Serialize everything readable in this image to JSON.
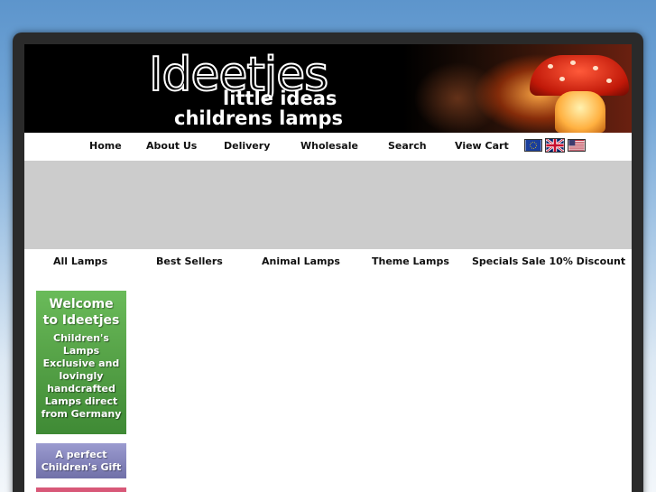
{
  "brand": {
    "name": "Ideetjes",
    "tagline_1": "little ideas",
    "tagline_2": "childrens lamps"
  },
  "top_nav": [
    {
      "label": "Home"
    },
    {
      "label": "About Us"
    },
    {
      "label": "Delivery"
    },
    {
      "label": "Wholesale"
    },
    {
      "label": "Search"
    },
    {
      "label": "View Cart"
    }
  ],
  "flags": [
    "eu-flag-icon",
    "uk-flag-icon",
    "us-flag-icon"
  ],
  "category_nav": [
    {
      "label": "All Lamps"
    },
    {
      "label": "Best Sellers"
    },
    {
      "label": "Animal Lamps"
    },
    {
      "label": "Theme Lamps"
    },
    {
      "label": "Specials Sale 10% Discount"
    }
  ],
  "sidebar": {
    "welcome_title_1": "Welcome",
    "welcome_title_2": "to Ideetjes",
    "welcome_lines": [
      "Children's",
      "Lamps",
      "Exclusive and",
      "lovingly",
      "handcrafted",
      "Lamps direct",
      "from Germany"
    ],
    "gift_line_1": "A perfect",
    "gift_line_2": "Children's Gift"
  },
  "colors": {
    "background_top": "#5d95cc",
    "gray_bar": "#cccccc",
    "welcome_green": "#59a64a",
    "gift_purple": "#8484bc",
    "pink_accent": "#d85878"
  }
}
